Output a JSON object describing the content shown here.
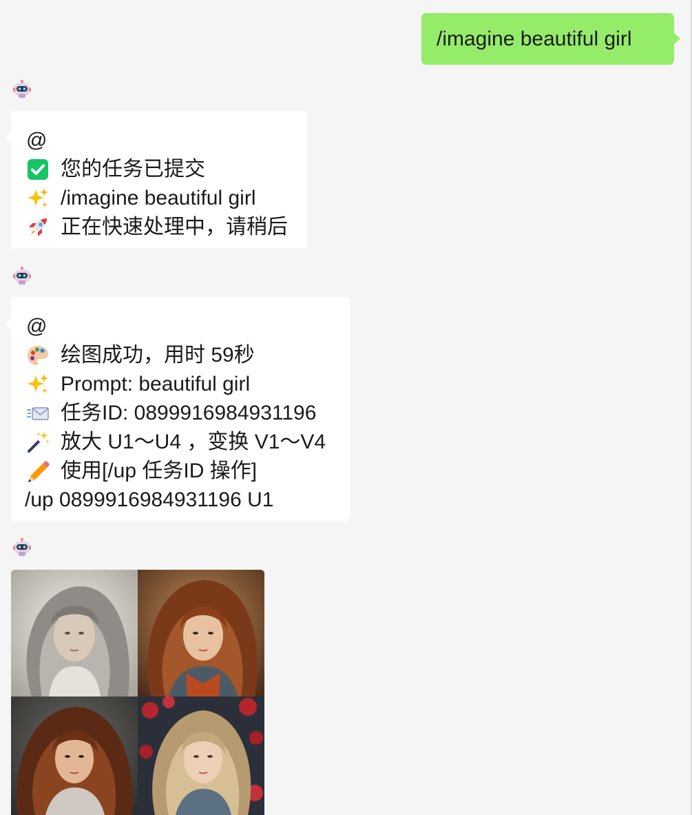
{
  "chat": {
    "user_message": "/imagine beautiful girl",
    "bot_messages": [
      {
        "lines": [
          {
            "icon": "",
            "text": "@"
          },
          {
            "icon": "check-mark-button-icon",
            "text": "您的任务已提交"
          },
          {
            "icon": "sparkles-icon",
            "text": "/imagine beautiful girl"
          },
          {
            "icon": "rocket-icon",
            "text": "正在快速处理中，请稍后"
          }
        ]
      },
      {
        "lines": [
          {
            "icon": "",
            "text": "@"
          },
          {
            "icon": "palette-icon",
            "text": "绘图成功，用时 59秒"
          },
          {
            "icon": "sparkles-icon",
            "text": "Prompt: beautiful girl"
          },
          {
            "icon": "incoming-envelope-icon",
            "text": "任务ID: 0899916984931196"
          },
          {
            "icon": "magic-wand-icon",
            "text": "放大 U1～U4 ，变换 V1～V4"
          },
          {
            "icon": "pencil-icon",
            "text": "使用[/up 任务ID 操作]"
          },
          {
            "icon": "",
            "text": "/up 0899916984931196 U1"
          }
        ]
      }
    ],
    "image_grid": {
      "tiles": [
        "portrait-grey-hair",
        "portrait-auburn-hair",
        "portrait-curly-auburn-hair",
        "portrait-blonde-roses"
      ]
    }
  },
  "colors": {
    "background": "#f5f5f5",
    "user_bubble": "#95ec69",
    "bot_bubble": "#ffffff"
  }
}
